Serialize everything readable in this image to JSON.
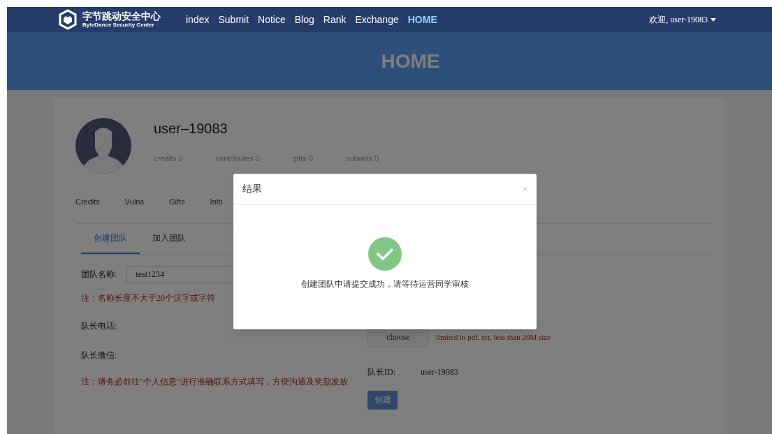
{
  "nav": {
    "logo_title": "字节跳动安全中心",
    "logo_subtitle": "ByteDance Security Center",
    "links": [
      {
        "label": "index",
        "selected": false
      },
      {
        "label": "Submit",
        "selected": false
      },
      {
        "label": "Notice",
        "selected": false
      },
      {
        "label": "Blog",
        "selected": false
      },
      {
        "label": "Rank",
        "selected": false
      },
      {
        "label": "Exchange",
        "selected": false
      },
      {
        "label": "HOME",
        "selected": true
      }
    ],
    "user_menu": "欢迎, user-19083"
  },
  "banner": {
    "title": "HOME"
  },
  "profile": {
    "username": "user–19083",
    "stats": [
      "credits 0",
      "contributes 0",
      "gifts 0",
      "submits 0"
    ]
  },
  "profile_tabs": [
    "Credits",
    "Vulns",
    "Gifts",
    "Info"
  ],
  "team_tabs": [
    {
      "label": "创建团队",
      "selected": true
    },
    {
      "label": "加入团队",
      "selected": false
    }
  ],
  "form": {
    "name_label": "团队名称:",
    "name_value": "test1234",
    "name_note": "注：名称长度不大于20个汉字或字符",
    "phone_label": "队长电话:",
    "wechat_label": "队长微信:",
    "contact_note": "注：请务必前往\"个人信息\"进行准确联系方式填写，方便沟通及奖励发放",
    "choose_button": "choose",
    "file_note": "limited in pdf, txt, less than 20M size",
    "leader_id_label": "队长ID:",
    "leader_id_value": "user-19083",
    "submit_button": "创建"
  },
  "modal": {
    "title": "结果",
    "close": "×",
    "message": "创建团队申请提交成功，请等待运营同学审核"
  }
}
